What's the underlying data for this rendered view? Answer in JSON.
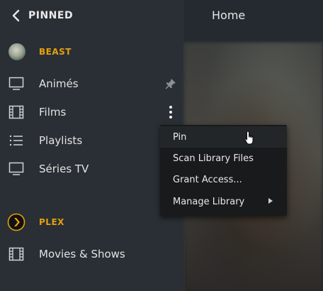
{
  "header": {
    "title": "PINNED"
  },
  "main": {
    "title": "Home"
  },
  "sections": [
    {
      "title": "BEAST",
      "items": [
        {
          "label": "Animés",
          "icon": "tv-icon",
          "pinned": true
        },
        {
          "label": "Films",
          "icon": "film-icon",
          "menu_open": true
        },
        {
          "label": "Playlists",
          "icon": "list-icon"
        },
        {
          "label": "Séries TV",
          "icon": "tv-icon"
        }
      ]
    },
    {
      "title": "PLEX",
      "items": [
        {
          "label": "Movies & Shows",
          "icon": "film-icon"
        }
      ]
    }
  ],
  "context_menu": {
    "items": [
      {
        "label": "Pin"
      },
      {
        "label": "Scan Library Files"
      },
      {
        "label": "Grant Access..."
      },
      {
        "label": "Manage Library",
        "has_submenu": true
      }
    ]
  },
  "colors": {
    "accent": "#e5a00d",
    "sidebar_bg": "#2a2f35",
    "menu_bg": "#191a1c"
  }
}
